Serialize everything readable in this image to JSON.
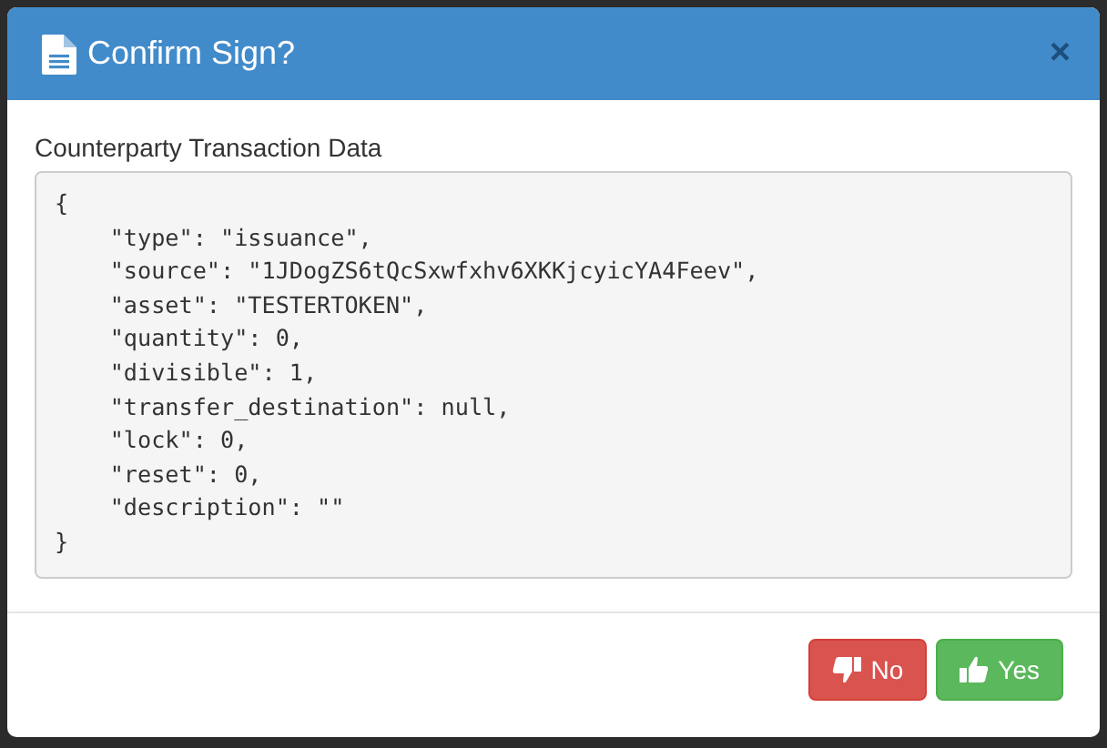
{
  "dialog": {
    "title": "Confirm Sign?",
    "close": "×",
    "section_label": "Counterparty Transaction Data",
    "code_lines": [
      "{",
      "    \"type\": \"issuance\",",
      "    \"source\": \"1JDogZS6tQcSxwfxhv6XKKjcyicYA4Feev\",",
      "    \"asset\": \"TESTERTOKEN\",",
      "    \"quantity\": 0,",
      "    \"divisible\": 1,",
      "    \"transfer_destination\": null,",
      "    \"lock\": 0,",
      "    \"reset\": 0,",
      "    \"description\": \"\"",
      "}"
    ],
    "buttons": [
      {
        "label": "No",
        "kind": "no"
      },
      {
        "label": "Yes",
        "kind": "yes"
      }
    ]
  }
}
